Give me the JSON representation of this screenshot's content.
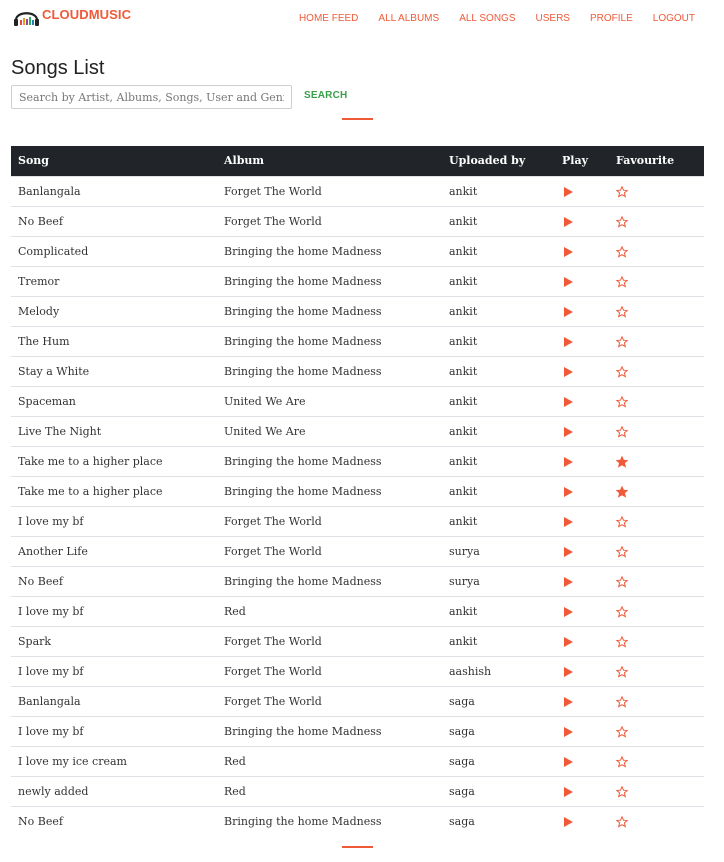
{
  "brand": {
    "name": "CLOUDMUSIC",
    "logo_icon": "headphones-icon",
    "accent": "#f05a38"
  },
  "nav": {
    "items": [
      {
        "label": "HOME FEED"
      },
      {
        "label": "ALL ALBUMS"
      },
      {
        "label": "ALL SONGS"
      },
      {
        "label": "USERS"
      },
      {
        "label": "PROFILE"
      },
      {
        "label": "LOGOUT"
      }
    ]
  },
  "page": {
    "title": "Songs List"
  },
  "search": {
    "placeholder": "Search by Artist, Albums, Songs, User and Genre",
    "value": "",
    "button_label": "SEARCH",
    "button_color": "#3aa04a"
  },
  "table": {
    "header_bg": "#212529",
    "columns": [
      "Song",
      "Album",
      "Uploaded by",
      "Play",
      "Favourite"
    ],
    "play_icon": "play-icon",
    "favourite_icon": "star-icon",
    "rows": [
      {
        "song": "Banlangala",
        "album": "Forget The World",
        "uploaded_by": "ankit",
        "favourite": false
      },
      {
        "song": "No Beef",
        "album": "Forget The World",
        "uploaded_by": "ankit",
        "favourite": false
      },
      {
        "song": "Complicated",
        "album": "Bringing the home Madness",
        "uploaded_by": "ankit",
        "favourite": false
      },
      {
        "song": "Tremor",
        "album": "Bringing the home Madness",
        "uploaded_by": "ankit",
        "favourite": false
      },
      {
        "song": "Melody",
        "album": "Bringing the home Madness",
        "uploaded_by": "ankit",
        "favourite": false
      },
      {
        "song": "The Hum",
        "album": "Bringing the home Madness",
        "uploaded_by": "ankit",
        "favourite": false
      },
      {
        "song": "Stay a White",
        "album": "Bringing the home Madness",
        "uploaded_by": "ankit",
        "favourite": false
      },
      {
        "song": "Spaceman",
        "album": "United We Are",
        "uploaded_by": "ankit",
        "favourite": false
      },
      {
        "song": "Live The Night",
        "album": "United We Are",
        "uploaded_by": "ankit",
        "favourite": false
      },
      {
        "song": "Take me to a higher place",
        "album": "Bringing the home Madness",
        "uploaded_by": "ankit",
        "favourite": true
      },
      {
        "song": "Take me to a higher place",
        "album": "Bringing the home Madness",
        "uploaded_by": "ankit",
        "favourite": true
      },
      {
        "song": "I love my bf",
        "album": "Forget The World",
        "uploaded_by": "ankit",
        "favourite": false
      },
      {
        "song": "Another Life",
        "album": "Forget The World",
        "uploaded_by": "surya",
        "favourite": false
      },
      {
        "song": "No Beef",
        "album": "Bringing the home Madness",
        "uploaded_by": "surya",
        "favourite": false
      },
      {
        "song": "I love my bf",
        "album": "Red",
        "uploaded_by": "ankit",
        "favourite": false
      },
      {
        "song": "Spark",
        "album": "Forget The World",
        "uploaded_by": "ankit",
        "favourite": false
      },
      {
        "song": "I love my bf",
        "album": "Forget The World",
        "uploaded_by": "aashish",
        "favourite": false
      },
      {
        "song": "Banlangala",
        "album": "Forget The World",
        "uploaded_by": "saga",
        "favourite": false
      },
      {
        "song": "I love my bf",
        "album": "Bringing the home Madness",
        "uploaded_by": "saga",
        "favourite": false
      },
      {
        "song": "I love my ice cream",
        "album": "Red",
        "uploaded_by": "saga",
        "favourite": false
      },
      {
        "song": "newly added",
        "album": "Red",
        "uploaded_by": "saga",
        "favourite": false
      },
      {
        "song": "No Beef",
        "album": "Bringing the home Madness",
        "uploaded_by": "saga",
        "favourite": false
      }
    ]
  }
}
